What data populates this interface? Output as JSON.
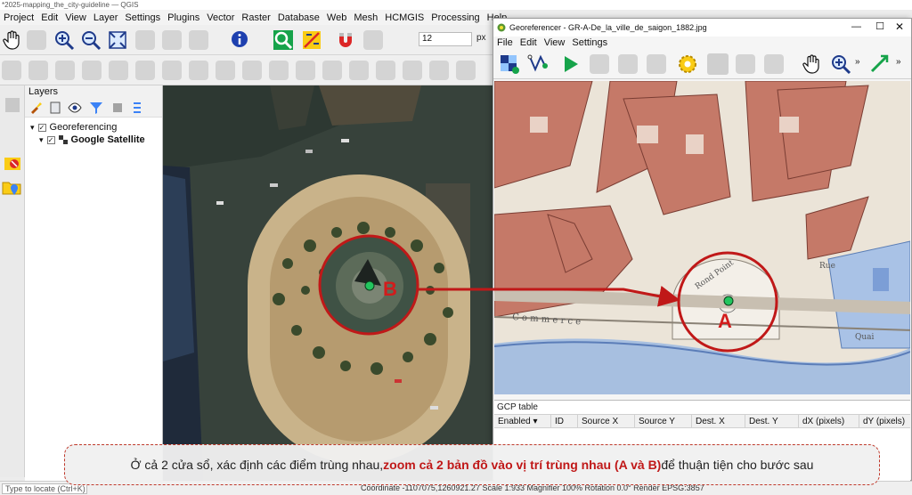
{
  "window": {
    "title": "*2025-mapping_the_city-guideline — QGIS"
  },
  "menubar": [
    "Project",
    "Edit",
    "View",
    "Layer",
    "Settings",
    "Plugins",
    "Vector",
    "Raster",
    "Database",
    "Web",
    "Mesh",
    "HCMGIS",
    "Processing",
    "Help"
  ],
  "toolbar": {
    "scale_value": "12",
    "scale_unit": "px"
  },
  "layers_panel": {
    "title": "Layers",
    "items": [
      {
        "label": "Georeferencing",
        "checked": "✓"
      },
      {
        "label": "Google Satellite",
        "checked": "✓"
      }
    ]
  },
  "georeferencer": {
    "title": "Georeferencer - GR-A-De_la_ville_de_saigon_1882.jpg",
    "menu": [
      "File",
      "Edit",
      "View",
      "Settings"
    ],
    "gcp_table": {
      "title": "GCP table",
      "columns": [
        "Enabled",
        "ID",
        "Source X",
        "Source Y",
        "Dest. X",
        "Dest. Y",
        "dX (pixels)",
        "dY (pixels)"
      ]
    }
  },
  "status": {
    "locate_placeholder": "Type to locate (Ctrl+K)",
    "right_text": "Coordinate  -1107075,1260921.27   Scale  1:933   Magnifier 100%   Rotation 0.0°   Render   EPSG:3857"
  },
  "annotations": {
    "label_a": "A",
    "label_b": "B",
    "caption_before": "Ở cả 2 cửa sổ, xác định các điểm trùng nhau, ",
    "caption_highlight": "zoom cả 2 bản đồ vào vị trí trùng nhau (A và B)",
    "caption_after": " để thuận tiện cho bước sau"
  },
  "colors": {
    "accent_red": "#d21c1c",
    "point_green": "#22c55e"
  }
}
